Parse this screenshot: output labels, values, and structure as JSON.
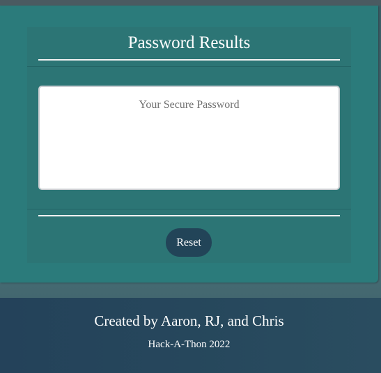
{
  "card": {
    "title": "Password Results",
    "password_placeholder": "Your Secure Password",
    "reset_label": "Reset"
  },
  "footer": {
    "credit": "Created by Aaron, RJ, and Chris",
    "event": "Hack-A-Thon 2022"
  },
  "colors": {
    "card_background": "#2b7b7b",
    "button_background": "#224458",
    "footer_background": "#24425a",
    "text_light": "#ffffff",
    "placeholder_text": "#6f6f6f"
  }
}
